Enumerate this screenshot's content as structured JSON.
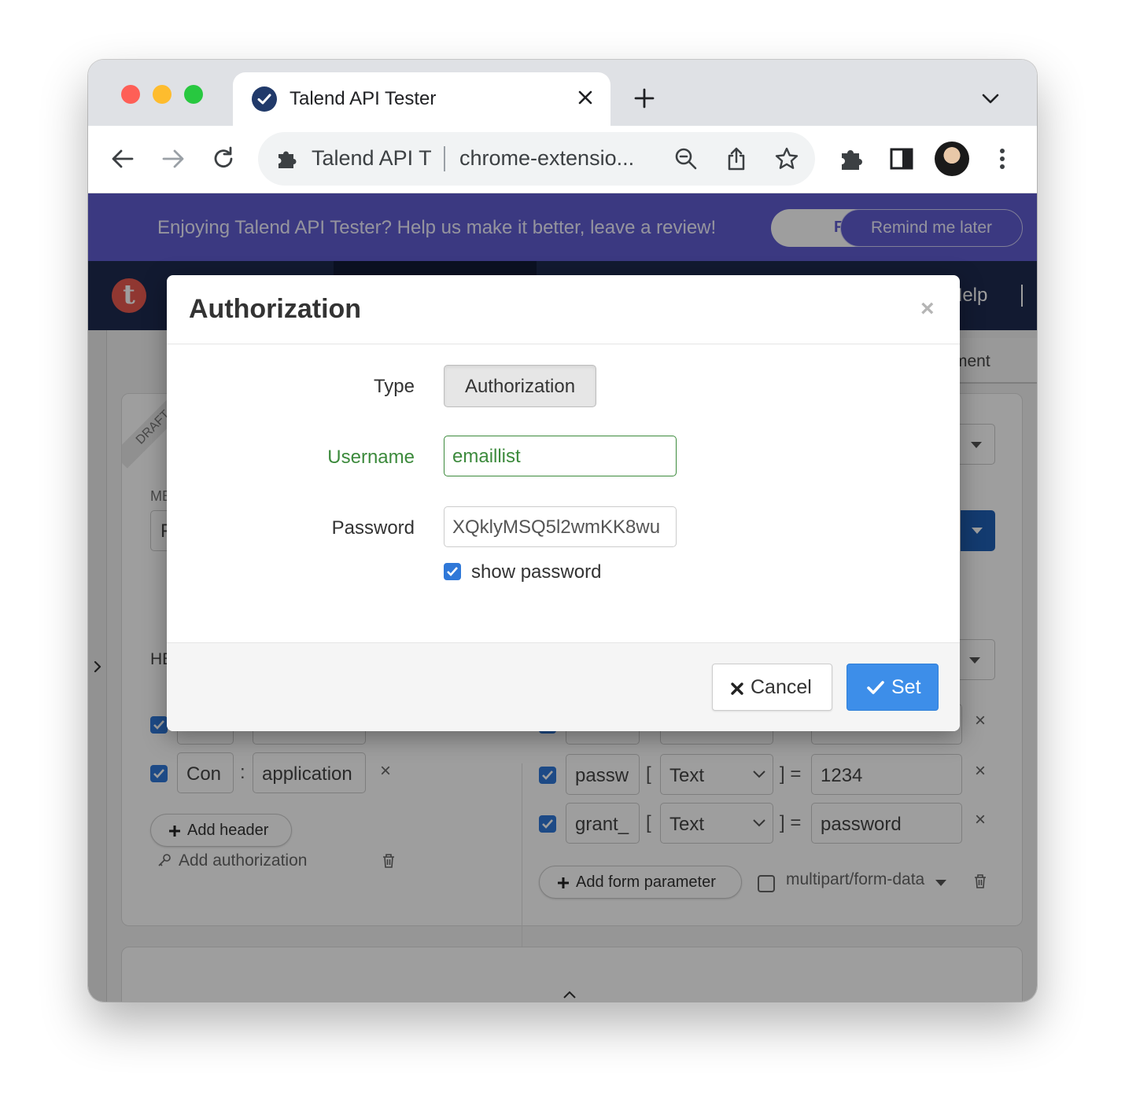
{
  "browser": {
    "tab_title": "Talend API Tester",
    "omnibox_extension": "Talend API T",
    "omnibox_url": "chrome-extensio..."
  },
  "banner": {
    "message": "Enjoying Talend API Tester? Help us make it better, leave a review!",
    "rate_button_partial": "F",
    "remind_button": "Remind me later"
  },
  "app": {
    "logo_letter": "t",
    "help_link": "Help",
    "subtab_partial": "ment"
  },
  "background": {
    "draft_ribbon": "DRAFT",
    "method_label_partial": "ME",
    "method_value_partial": "F",
    "headers_label_partial": "HE",
    "headers": [
      {
        "name": "Con",
        "value": "application"
      }
    ],
    "add_header": "Add header",
    "add_authorization": "Add authorization",
    "form_params": [
      {
        "name": "passw",
        "type": "Text",
        "value": "1234"
      },
      {
        "name": "grant_",
        "type": "Text",
        "value": "password"
      }
    ],
    "add_form_parameter": "Add form parameter",
    "multipart_label": "multipart/form-data",
    "colon": ":",
    "bracket_open": "[",
    "bracket_close": "] =",
    "remove": "×"
  },
  "modal": {
    "title": "Authorization",
    "close": "×",
    "type_label": "Type",
    "type_value": "Authorization",
    "username_label": "Username",
    "username_value": "emaillist",
    "password_label": "Password",
    "password_value": "XQklyMSQ5l2wmKK8wu",
    "show_password_label": "show password",
    "show_password_checked": true,
    "cancel_button": "Cancel",
    "set_button": "Set"
  },
  "colors": {
    "banner": "#5f5cd0",
    "appbar": "#1e2a4f",
    "primary": "#3d8ee9",
    "success": "#3c8a3c"
  }
}
